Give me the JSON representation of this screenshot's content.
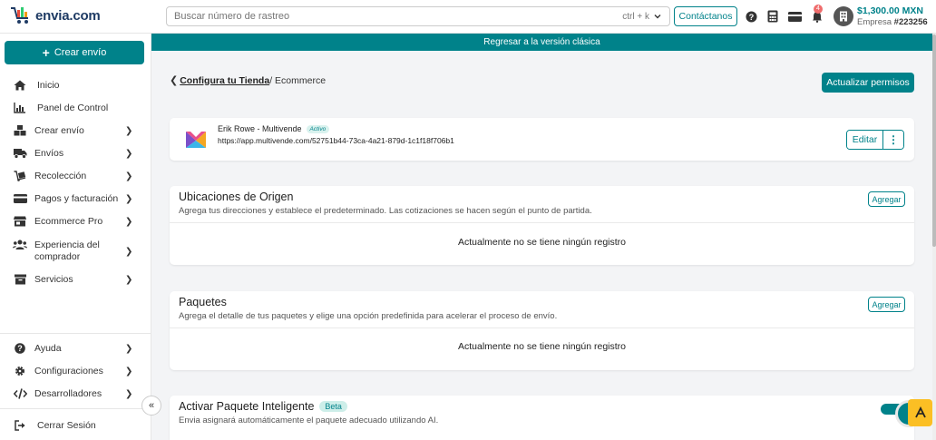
{
  "brand": {
    "name": "envia.com",
    "accent": "#00828a"
  },
  "header": {
    "search_placeholder": "Buscar número de rastreo",
    "search_shortcut": "ctrl + k",
    "contact_label": "Contáctanos",
    "notifications_count": "4",
    "balance": "$1,300.00 MXN",
    "company_label": "Empresa",
    "company_id": "#223256"
  },
  "sidebar": {
    "create_label": "Crear envío",
    "items": [
      {
        "label": "Inicio",
        "icon": "home-icon",
        "has_submenu": false
      },
      {
        "label": "Panel de Control",
        "icon": "chart-icon",
        "has_submenu": false
      },
      {
        "label": "Crear envío",
        "icon": "boxes-icon",
        "has_submenu": true
      },
      {
        "label": "Envíos",
        "icon": "truck-icon",
        "has_submenu": true
      },
      {
        "label": "Recolección",
        "icon": "dolly-icon",
        "has_submenu": true
      },
      {
        "label": "Pagos y facturación",
        "icon": "card-icon",
        "has_submenu": true
      },
      {
        "label": "Ecommerce Pro",
        "icon": "store-icon",
        "has_submenu": true
      },
      {
        "label": "Experiencia del comprador",
        "icon": "users-icon",
        "has_submenu": true
      },
      {
        "label": "Servicios",
        "icon": "archive-icon",
        "has_submenu": true
      }
    ],
    "bottom_items": [
      {
        "label": "Ayuda",
        "icon": "help-icon",
        "has_submenu": true
      },
      {
        "label": "Configuraciones",
        "icon": "gear-icon",
        "has_submenu": true
      },
      {
        "label": "Desarrolladores",
        "icon": "code-icon",
        "has_submenu": true
      }
    ],
    "logout_label": "Cerrar Sesión"
  },
  "main": {
    "classic_banner": "Regresar a la versión clásica",
    "breadcrumb": {
      "parent": "Configura tu Tienda",
      "current": "/ Ecommerce"
    },
    "update_permissions_label": "Actualizar permisos",
    "store": {
      "name": "Erik Rowe - Multivende",
      "status": "Activo",
      "url": "https://app.multivende.com/52751b44-73ca-4a21-879d-1c1f18f706b1",
      "edit_label": "Editar"
    },
    "origin": {
      "title": "Ubicaciones de Origen",
      "description": "Agrega tus direcciones y establece el predeterminado. Las cotizaciones se hacen según el punto de partida.",
      "add_label": "Agregar",
      "empty": "Actualmente no se tiene ningún registro"
    },
    "packages": {
      "title": "Paquetes",
      "description": "Agrega el detalle de tus paquetes y elige una opción predefinida para acelerar el proceso de envío.",
      "add_label": "Agregar",
      "empty": "Actualmente no se tiene ningún registro"
    },
    "smart_package": {
      "title": "Activar Paquete Inteligente",
      "badge": "Beta",
      "description": "Envia asignará automáticamente el paquete adecuado utilizando AI.",
      "enabled": true
    }
  }
}
